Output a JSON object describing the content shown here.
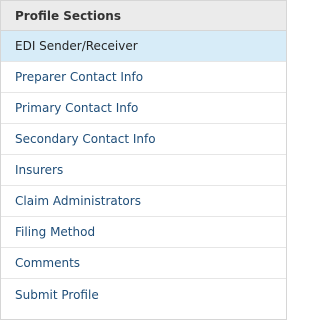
{
  "panel": {
    "header": "Profile Sections",
    "active_index": 0,
    "items": [
      {
        "label": "EDI Sender/Receiver"
      },
      {
        "label": "Preparer Contact Info"
      },
      {
        "label": "Primary Contact Info"
      },
      {
        "label": "Secondary Contact Info"
      },
      {
        "label": "Insurers"
      },
      {
        "label": "Claim Administrators"
      },
      {
        "label": "Filing Method"
      },
      {
        "label": "Comments"
      },
      {
        "label": "Submit Profile"
      }
    ]
  },
  "colors": {
    "header_bg": "#ebebeb",
    "active_bg": "#d7ecf8",
    "link": "#1f4e79"
  }
}
